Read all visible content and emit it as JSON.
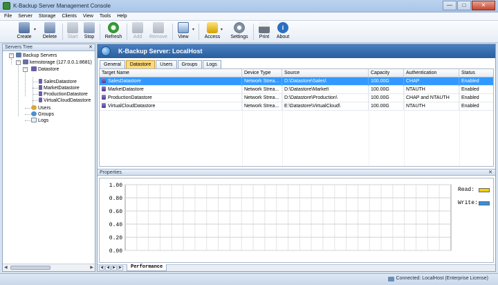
{
  "window": {
    "title": "K-Backup Server Management Console"
  },
  "menu": [
    "File",
    "Server",
    "Storage",
    "Clients",
    "View",
    "Tools",
    "Help"
  ],
  "toolbar": {
    "create": "Create",
    "delete": "Delete",
    "start": "Start",
    "stop": "Stop",
    "refresh": "Refresh",
    "add": "Add",
    "remove": "Remove",
    "view": "View",
    "access": "Access",
    "settings": "Settings",
    "print": "Print",
    "about": "About"
  },
  "servers_tree": {
    "header": "Servers Tree",
    "root": "Backup Servers",
    "server": "kemstorage (127.0.0.1:8681)",
    "datastore": "Datastore",
    "datastores": [
      "SalesDatastore",
      "MarketDatastore",
      "ProductionDatastore",
      "VirtualCloudDatastore"
    ],
    "users": "Users",
    "groups": "Groups",
    "logs": "Logs"
  },
  "main": {
    "banner": "K-Backup Server: LocalHost",
    "tabs": [
      "General",
      "Datastore",
      "Users",
      "Groups",
      "Logs"
    ],
    "active_tab": "Datastore",
    "columns": [
      "Target Name",
      "Device Type",
      "Source",
      "Capacity",
      "Authentication",
      "Status"
    ],
    "rows": [
      [
        "SalesDatastore",
        "Network Strea...",
        "D:\\Datastore\\Sales\\",
        "100.00G",
        "CHAP",
        "Enabled"
      ],
      [
        "MarketDatastore",
        "Network Strea...",
        "D:\\Datastore\\Market\\",
        "100.00G",
        "NTAUTH",
        "Enabled"
      ],
      [
        "ProductionDatastore",
        "Network Strea...",
        "D:\\Datastore\\Production\\",
        "100.00G",
        "CHAP and NTAUTH",
        "Enabled"
      ],
      [
        "VirtualCloudDatastore",
        "Network Strea...",
        "E:\\Datastore\\VirtualCloud\\",
        "100.00G",
        "NTAUTH",
        "Enabled"
      ]
    ]
  },
  "properties": {
    "header": "Properties",
    "tab": "Performance",
    "chart": {
      "y_ticks": [
        "1.00",
        "0.80",
        "0.60",
        "0.40",
        "0.20",
        "0.00"
      ],
      "legend": [
        {
          "label": "Read:",
          "color": "#f5d000"
        },
        {
          "label": "Write:",
          "color": "#3a8fd8"
        }
      ]
    }
  },
  "status": {
    "text": "Connected: LocalHost (Enterprise License)"
  }
}
